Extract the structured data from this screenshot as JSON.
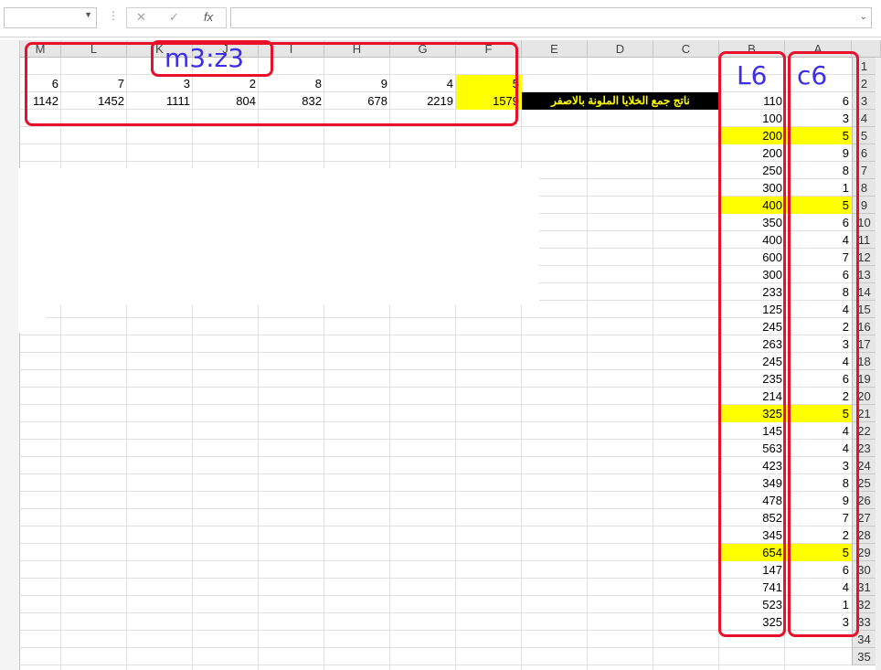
{
  "formula_bar": {
    "cancel_icon": "close-icon",
    "enter_icon": "check-icon",
    "fx_label": "fx"
  },
  "columns": [
    "M",
    "L",
    "K",
    "J",
    "I",
    "H",
    "G",
    "F",
    "E",
    "D",
    "C",
    "B",
    "A"
  ],
  "rows": [
    "1",
    "2",
    "3",
    "4",
    "5",
    "6",
    "7",
    "8",
    "9",
    "10",
    "11",
    "12",
    "13",
    "14",
    "15",
    "16",
    "17",
    "18",
    "19",
    "20",
    "21",
    "22",
    "23",
    "24",
    "25",
    "26",
    "27",
    "28",
    "29",
    "30",
    "31",
    "32",
    "33",
    "34",
    "35"
  ],
  "top_block": {
    "row2": [
      "6",
      "7",
      "3",
      "2",
      "8",
      "9",
      "4",
      "5"
    ],
    "row3": [
      "1142",
      "1452",
      "1111",
      "804",
      "832",
      "678",
      "2219",
      "1579"
    ],
    "label_cell": "ناتج جمع الخلايا الملونة بالاصفر"
  },
  "col_b": [
    "110",
    "100",
    "200",
    "200",
    "250",
    "300",
    "400",
    "350",
    "400",
    "600",
    "300",
    "233",
    "125",
    "245",
    "263",
    "245",
    "235",
    "214",
    "325",
    "145",
    "563",
    "423",
    "349",
    "478",
    "852",
    "345",
    "654",
    "147",
    "741",
    "523",
    "325"
  ],
  "col_a": [
    "6",
    "3",
    "5",
    "9",
    "8",
    "1",
    "5",
    "6",
    "4",
    "7",
    "6",
    "8",
    "4",
    "2",
    "3",
    "4",
    "6",
    "2",
    "5",
    "4",
    "4",
    "3",
    "8",
    "9",
    "7",
    "2",
    "5",
    "6",
    "4",
    "1",
    "3"
  ],
  "yellow_rows_b_a": [
    2,
    6,
    18,
    26
  ],
  "annotations": {
    "range_label": "m3:z3",
    "col_b_label": "L6",
    "col_a_label": "c6"
  },
  "colors": {
    "highlight": "#ffff00",
    "annotation_box": "#e8102a",
    "annotation_text": "#3a2ee8"
  }
}
